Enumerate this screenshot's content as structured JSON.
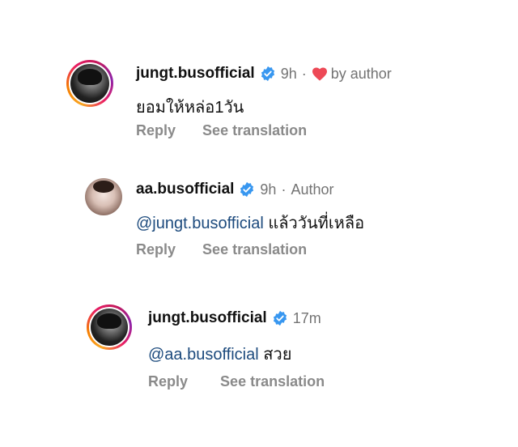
{
  "comments": [
    {
      "username": "jungt.busofficial",
      "time": "9h",
      "separator": "·",
      "liked_by": "by author",
      "mention": "",
      "text": "ยอมให้หล่อ1วัน",
      "reply_label": "Reply",
      "translate_label": "See translation"
    },
    {
      "username": "aa.busofficial",
      "time": "9h",
      "separator": "·",
      "author_label": "Author",
      "mention": "@jungt.busofficial",
      "text": "แล้ววันที่เหลือ",
      "reply_label": "Reply",
      "translate_label": "See translation"
    },
    {
      "username": "jungt.busofficial",
      "time": "17m",
      "mention": "@aa.busofficial",
      "text": "สวย",
      "reply_label": "Reply",
      "translate_label": "See translation"
    }
  ],
  "colors": {
    "verified": "#3897f0",
    "heart": "#ed4956",
    "mention": "#1c4a7d",
    "muted": "#737373"
  }
}
